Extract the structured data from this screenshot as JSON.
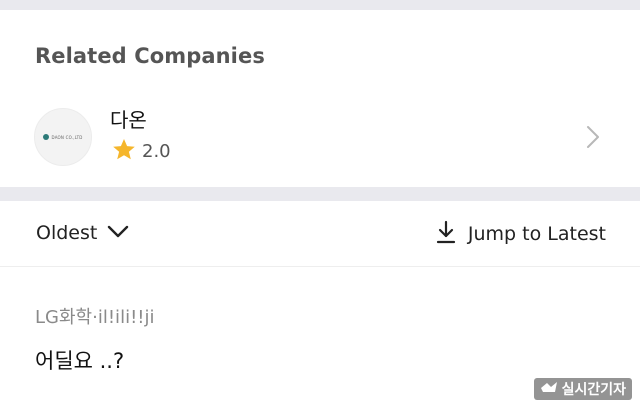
{
  "related": {
    "title": "Related Companies",
    "company": {
      "name": "다온",
      "logo_text": "DAON CO.,LTD",
      "rating": "2.0",
      "rating_stars": 2.0
    }
  },
  "sort": {
    "label": "Oldest",
    "jump_label": "Jump to Latest"
  },
  "comment": {
    "author": "LG화학",
    "separator": "·",
    "handle": "il!ili!!ji",
    "body": "어딜요 ..?"
  },
  "watermark": {
    "text": "실시간기자"
  },
  "colors": {
    "star": "#f5b62c",
    "divider": "#e9e9ee",
    "chevron": "#b8b8b8"
  },
  "icons": [
    "star-icon",
    "chevron-right-icon",
    "chevron-down-icon",
    "download-icon"
  ]
}
